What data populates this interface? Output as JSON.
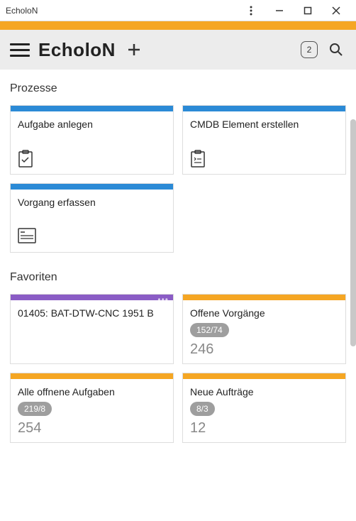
{
  "window": {
    "title": "EcholoN"
  },
  "header": {
    "logo": "EcholoN",
    "count_badge": "2"
  },
  "sections": {
    "processes": {
      "title": "Prozesse",
      "cards": [
        {
          "title": "Aufgabe anlegen"
        },
        {
          "title": "CMDB Element erstellen"
        },
        {
          "title": "Vorgang erfassen"
        }
      ]
    },
    "favorites": {
      "title": "Favoriten",
      "cards": [
        {
          "title": "01405: BAT-DTW-CNC 1951 B"
        },
        {
          "title": "Offene Vorgänge",
          "badge": "152/74",
          "number": "246"
        },
        {
          "title": "Alle offnene Aufgaben",
          "badge": "219/8",
          "number": "254"
        },
        {
          "title": "Neue Aufträge",
          "badge": "8/3",
          "number": "12"
        }
      ]
    }
  }
}
